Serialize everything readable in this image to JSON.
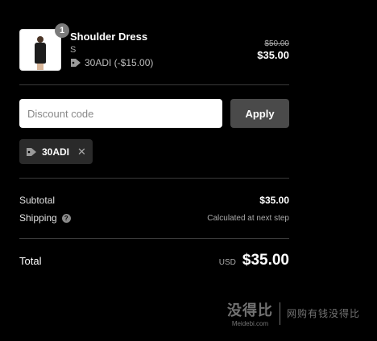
{
  "product": {
    "quantity": "1",
    "name": "Shoulder Dress",
    "variant": "S",
    "discount_applied": "30ADI (-$15.00)",
    "original_price": "$50.00",
    "price": "$35.00"
  },
  "discount": {
    "placeholder": "Discount code",
    "apply_label": "Apply",
    "applied_code": "30ADI"
  },
  "totals": {
    "subtotal_label": "Subtotal",
    "subtotal_value": "$35.00",
    "shipping_label": "Shipping",
    "shipping_value": "Calculated at next step",
    "total_label": "Total",
    "currency": "USD",
    "total_value": "$35.00"
  },
  "watermark": {
    "brand_cn": "没得比",
    "brand_en": "Meidebi.com",
    "slogan": "网购有钱没得比"
  },
  "colors": {
    "background": "#000000",
    "apply_button": "#4a4a4a",
    "chip_background": "#2a2a2a",
    "divider": "#3a3a3a"
  }
}
